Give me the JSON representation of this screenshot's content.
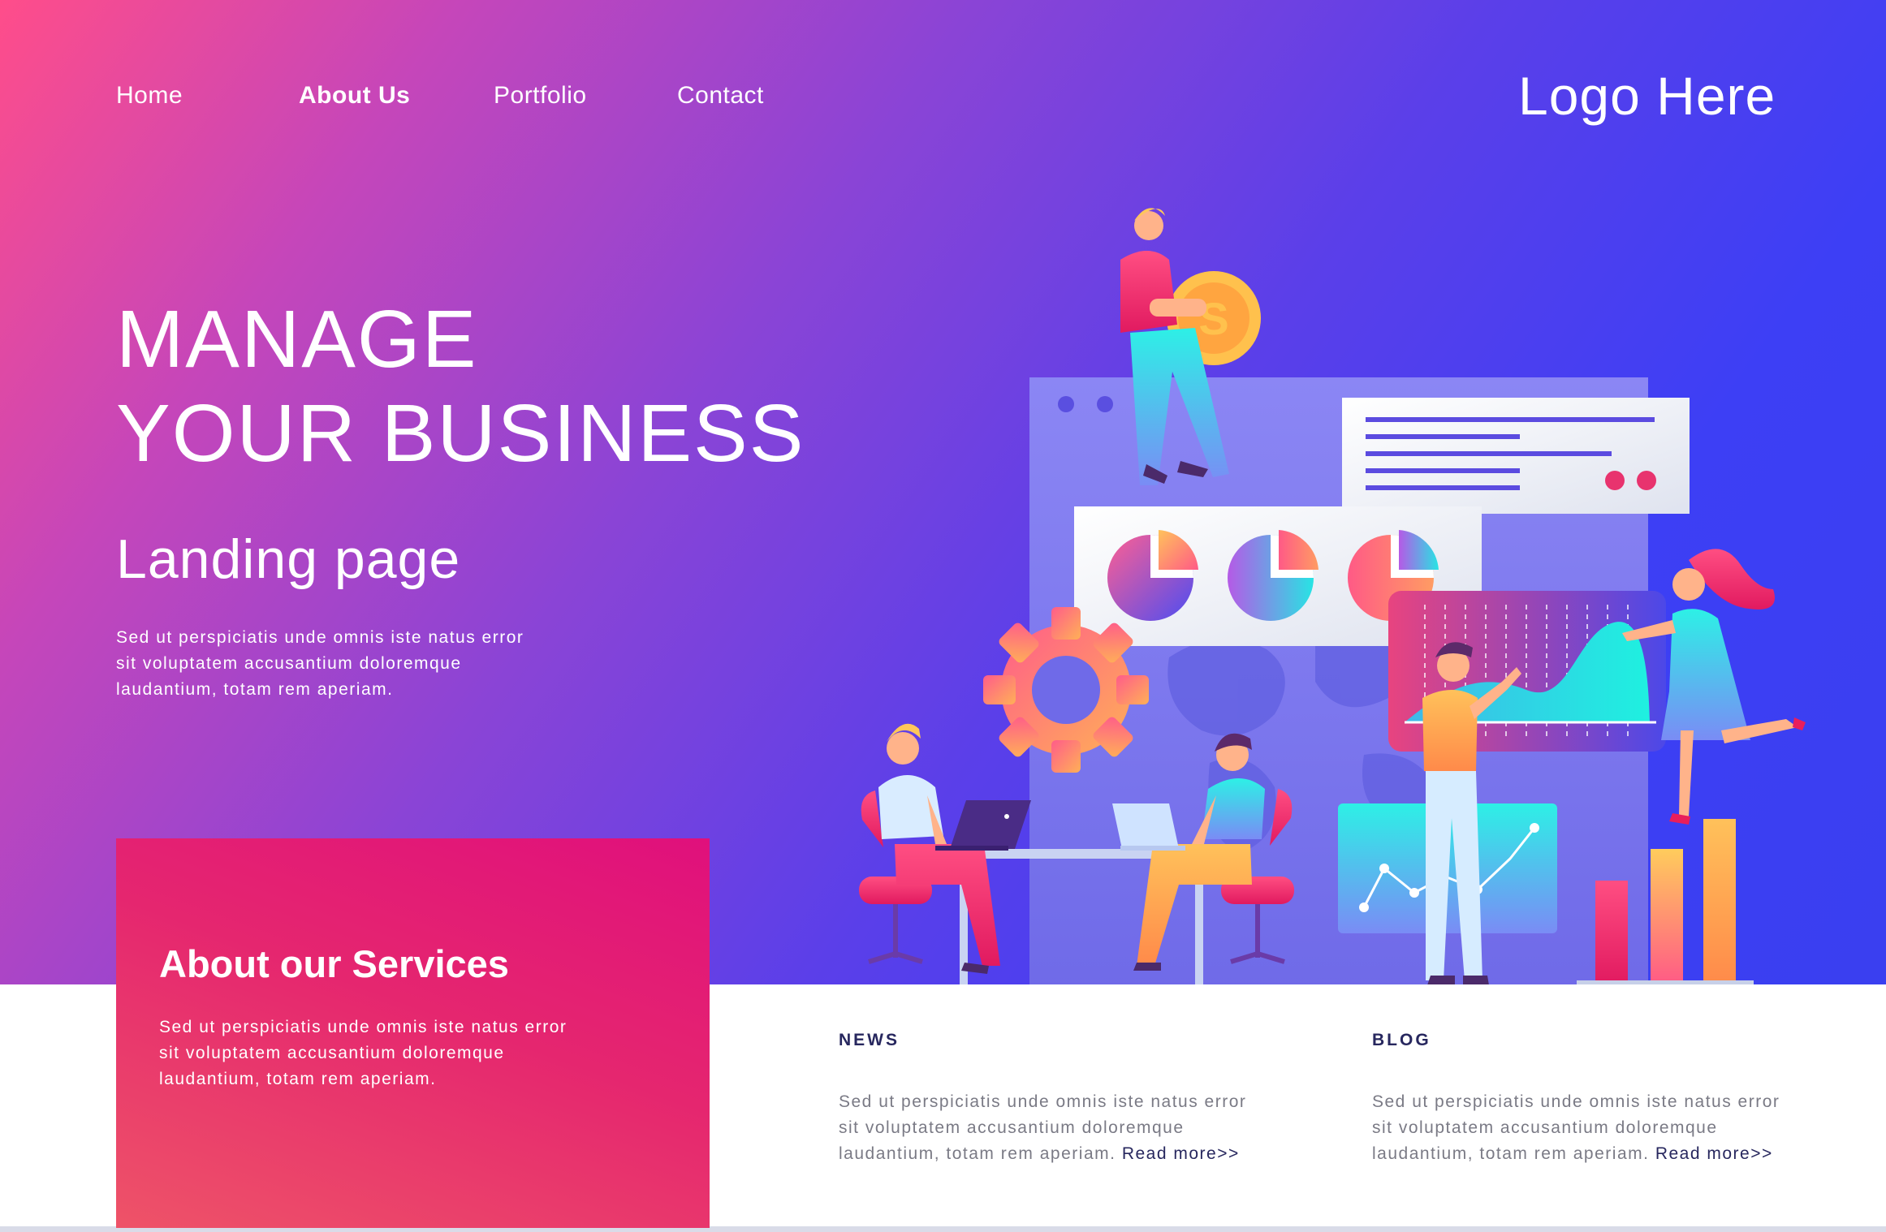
{
  "nav": {
    "items": [
      {
        "label": "Home",
        "active": false
      },
      {
        "label": "About Us",
        "active": true
      },
      {
        "label": "Portfolio",
        "active": false
      },
      {
        "label": "Contact",
        "active": false
      }
    ],
    "logo": "Logo Here"
  },
  "hero": {
    "title_line1": "MANAGE",
    "title_line2": "YOUR BUSINESS",
    "subtitle": "Landing page",
    "paragraph": "Sed ut perspiciatis unde omnis iste natus error sit voluptatem accusantium doloremque laudantium, totam rem aperiam."
  },
  "services": {
    "title": "About our Services",
    "paragraph": "Sed ut perspiciatis unde omnis iste natus error sit voluptatem accusantium doloremque laudantium, totam rem aperiam."
  },
  "news": {
    "title": "NEWS",
    "paragraph": "Sed ut perspiciatis unde omnis iste natus error sit voluptatem accusantium doloremque laudantium, totam rem aperiam.",
    "read_more": "Read more>>"
  },
  "blog": {
    "title": "BLOG",
    "paragraph": "Sed ut perspiciatis unde omnis iste natus error sit voluptatem accusantium doloremque laudantium, totam rem aperiam.",
    "read_more": "Read more>>"
  },
  "colors": {
    "hero_gradient_start": "#ff4d8a",
    "hero_gradient_end": "#3d3ff5",
    "card_pink": "#e0107c",
    "card_coral": "#ee5368",
    "heading_navy": "#27275e",
    "body_gray": "#7a7a85"
  },
  "icons": [
    "gear-icon",
    "coin-icon",
    "pie-chart-icon",
    "bar-chart-icon",
    "line-chart-icon",
    "laptop-icon",
    "world-map-icon"
  ]
}
